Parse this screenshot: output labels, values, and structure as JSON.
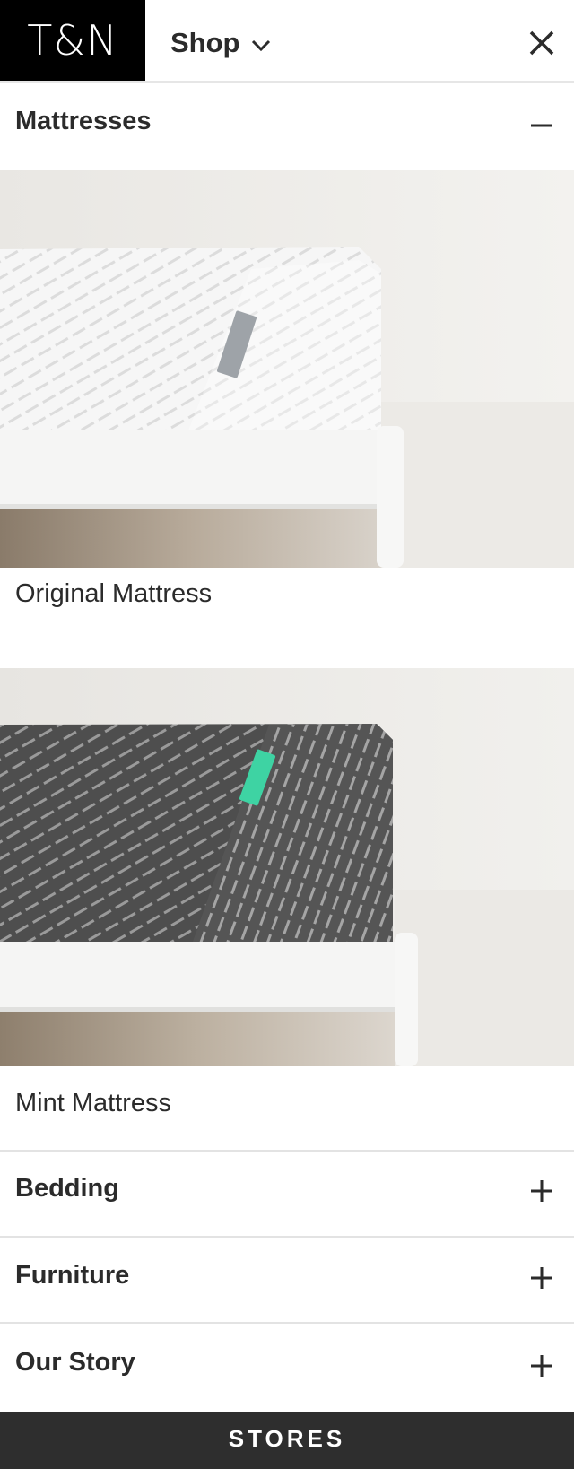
{
  "header": {
    "logo": "T&N",
    "shop_label": "Shop"
  },
  "menu": {
    "mattresses": {
      "title": "Mattresses",
      "products": [
        {
          "name": "Original Mattress"
        },
        {
          "name": "Mint Mattress"
        }
      ]
    },
    "bedding": {
      "title": "Bedding"
    },
    "furniture": {
      "title": "Furniture"
    },
    "our_story": {
      "title": "Our Story"
    }
  },
  "footer": {
    "stores_label": "STORES"
  },
  "colors": {
    "logo_background": "#000000",
    "mint_tag": "#3ed3a3",
    "footer_background": "#2e2e2e"
  }
}
